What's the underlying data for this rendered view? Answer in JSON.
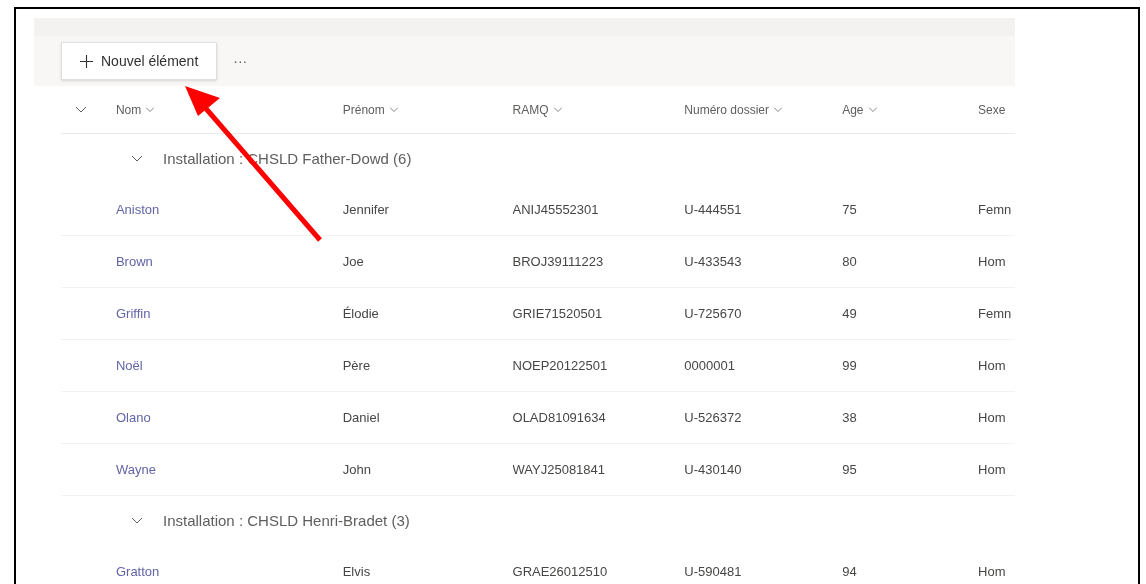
{
  "toolbar": {
    "new_button": "Nouvel élément",
    "more": "···"
  },
  "columns": [
    {
      "label": "Nom"
    },
    {
      "label": "Prénom"
    },
    {
      "label": "RAMQ"
    },
    {
      "label": "Numéro dossier"
    },
    {
      "label": "Age"
    },
    {
      "label": "Sexe"
    }
  ],
  "groups": [
    {
      "title": "Installation : CHSLD Father-Dowd (6)",
      "expanded": true,
      "rows": [
        [
          "Aniston",
          "Jennifer",
          "ANIJ45552301",
          "U-444551",
          "75",
          "Femn"
        ],
        [
          "Brown",
          "Joe",
          "BROJ39111223",
          "U-433543",
          "80",
          "Hom"
        ],
        [
          "Griffin",
          "Élodie",
          "GRIE71520501",
          "U-725670",
          "49",
          "Femn"
        ],
        [
          "Noël",
          "Père",
          "NOEP20122501",
          "0000001",
          "99",
          "Hom"
        ],
        [
          "Olano",
          "Daniel",
          "OLAD81091634",
          "U-526372",
          "38",
          "Hom"
        ],
        [
          "Wayne",
          "John",
          "WAYJ25081841",
          "U-430140",
          "95",
          "Hom"
        ]
      ]
    },
    {
      "title": "Installation : CHSLD Henri-Bradet (3)",
      "expanded": true,
      "rows": [
        [
          "Gratton",
          "Elvis",
          "GRAE26012510",
          "U-590481",
          "94",
          "Hom"
        ]
      ]
    }
  ]
}
